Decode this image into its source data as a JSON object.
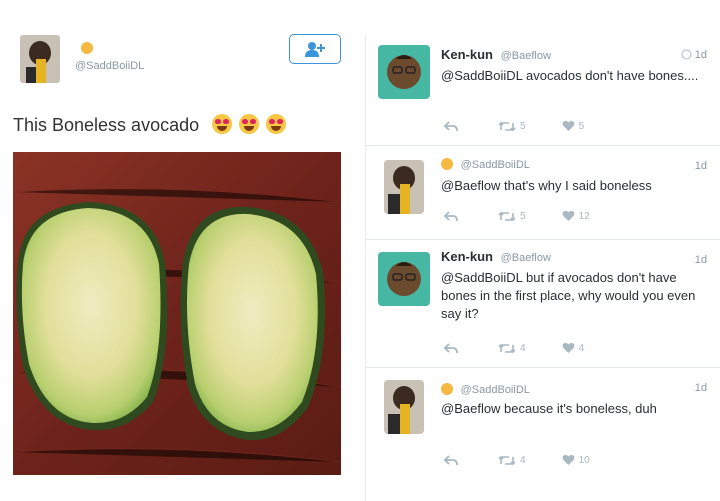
{
  "left_post": {
    "handle": "@SaddBoiiDL",
    "text": "This Boneless avocado",
    "emoji_count": 3,
    "follow_icon": "add-user-icon"
  },
  "replies": [
    {
      "name": "Ken-kun",
      "handle": "@Baeflow",
      "time": "1d",
      "text": "@SaddBoiiDL avocados don't have bones....",
      "retweets": "5",
      "likes": "5",
      "verified_icon": "globe-icon"
    },
    {
      "name": "",
      "handle": "@SaddBoiiDL",
      "time": "1d",
      "text": "@Baeflow that's why I said boneless",
      "retweets": "5",
      "likes": "12"
    },
    {
      "name": "Ken-kun",
      "handle": "@Baeflow",
      "time": "1d",
      "text": "@SaddBoiiDL but if avocados don't have bones in the first place, why would you even say it?",
      "retweets": "4",
      "likes": "4"
    },
    {
      "name": "",
      "handle": "@SaddBoiiDL",
      "time": "1d",
      "text": "@Baeflow because it's boneless, duh",
      "retweets": "4",
      "likes": "10"
    }
  ],
  "colors": {
    "accent": "#3b94d9",
    "muted": "#8899a6",
    "heart": "#e0245e",
    "avocado_flesh": "#e8e6a0",
    "avocado_skin": "#3d7a2a"
  }
}
